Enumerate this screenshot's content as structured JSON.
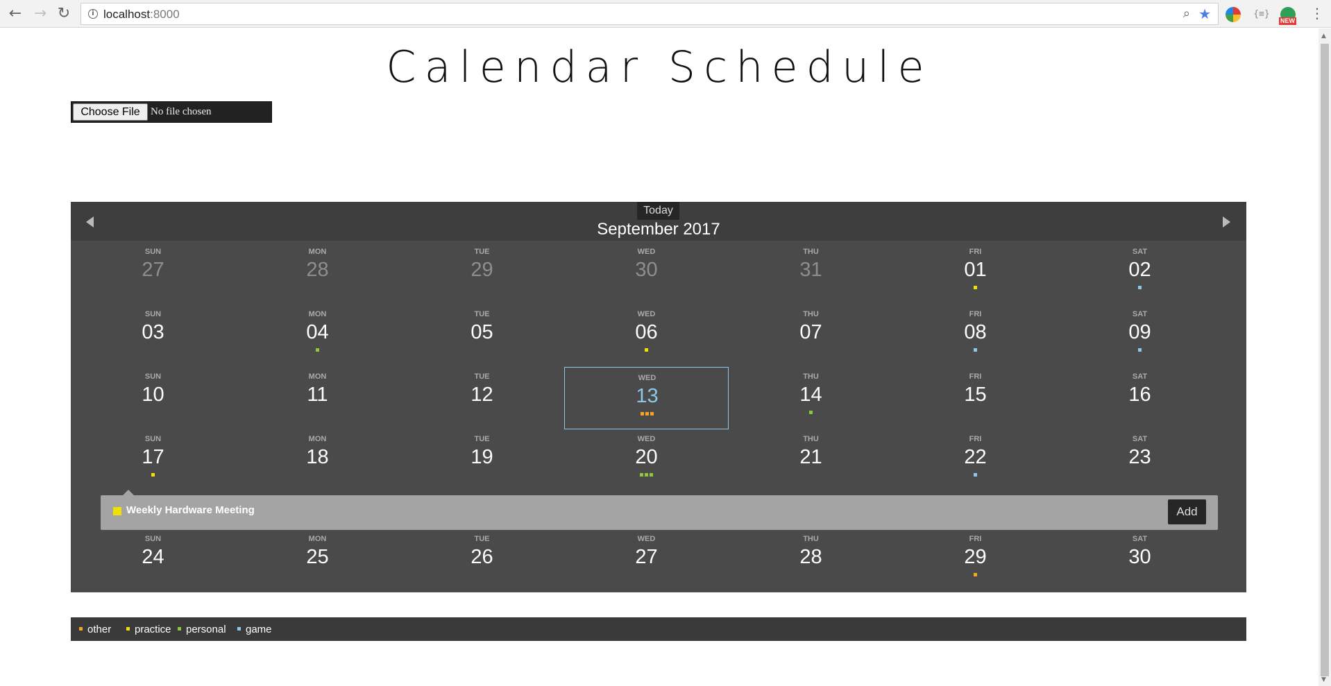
{
  "browser": {
    "url_host": "localhost",
    "url_port": ":8000",
    "ext_new_badge": "NEW",
    "ext_braces": "{≡}"
  },
  "page": {
    "title": "Calendar Schedule",
    "file_input": {
      "button_label": "Choose File",
      "status": "No file chosen"
    }
  },
  "calendar": {
    "today_label": "Today",
    "month_title": "September 2017",
    "weeks": [
      [
        {
          "name": "SUN",
          "num": "27",
          "other": true,
          "dots": []
        },
        {
          "name": "MON",
          "num": "28",
          "other": true,
          "dots": []
        },
        {
          "name": "TUE",
          "num": "29",
          "other": true,
          "dots": []
        },
        {
          "name": "WED",
          "num": "30",
          "other": true,
          "dots": []
        },
        {
          "name": "THU",
          "num": "31",
          "other": true,
          "dots": []
        },
        {
          "name": "FRI",
          "num": "01",
          "dots": [
            "practice"
          ]
        },
        {
          "name": "SAT",
          "num": "02",
          "dots": [
            "game"
          ]
        }
      ],
      [
        {
          "name": "SUN",
          "num": "03",
          "dots": []
        },
        {
          "name": "MON",
          "num": "04",
          "dots": [
            "personal"
          ]
        },
        {
          "name": "TUE",
          "num": "05",
          "dots": []
        },
        {
          "name": "WED",
          "num": "06",
          "dots": [
            "practice"
          ]
        },
        {
          "name": "THU",
          "num": "07",
          "dots": []
        },
        {
          "name": "FRI",
          "num": "08",
          "dots": [
            "game"
          ]
        },
        {
          "name": "SAT",
          "num": "09",
          "dots": [
            "game"
          ]
        }
      ],
      [
        {
          "name": "SUN",
          "num": "10",
          "dots": []
        },
        {
          "name": "MON",
          "num": "11",
          "dots": []
        },
        {
          "name": "TUE",
          "num": "12",
          "dots": []
        },
        {
          "name": "WED",
          "num": "13",
          "selected": true,
          "dots": [
            "other",
            "other",
            "other"
          ]
        },
        {
          "name": "THU",
          "num": "14",
          "dots": [
            "personal"
          ]
        },
        {
          "name": "FRI",
          "num": "15",
          "dots": []
        },
        {
          "name": "SAT",
          "num": "16",
          "dots": []
        }
      ],
      [
        {
          "name": "SUN",
          "num": "17",
          "dots": [
            "practice"
          ]
        },
        {
          "name": "MON",
          "num": "18",
          "dots": []
        },
        {
          "name": "TUE",
          "num": "19",
          "dots": []
        },
        {
          "name": "WED",
          "num": "20",
          "dots": [
            "personal",
            "personal",
            "personal"
          ]
        },
        {
          "name": "THU",
          "num": "21",
          "dots": []
        },
        {
          "name": "FRI",
          "num": "22",
          "dots": [
            "game"
          ]
        },
        {
          "name": "SAT",
          "num": "23",
          "dots": []
        }
      ],
      [
        {
          "name": "SUN",
          "num": "24",
          "dots": []
        },
        {
          "name": "MON",
          "num": "25",
          "dots": []
        },
        {
          "name": "TUE",
          "num": "26",
          "dots": []
        },
        {
          "name": "WED",
          "num": "27",
          "dots": []
        },
        {
          "name": "THU",
          "num": "28",
          "dots": []
        },
        {
          "name": "FRI",
          "num": "29",
          "dots": [
            "other"
          ]
        },
        {
          "name": "SAT",
          "num": "30",
          "dots": []
        }
      ]
    ],
    "event_panel": {
      "title": "Weekly Hardware Meeting",
      "category": "practice",
      "add_label": "Add"
    }
  },
  "categories": {
    "other": "#f5a623",
    "practice": "#f0e100",
    "personal": "#8dc63f",
    "game": "#8ec7e8"
  },
  "legend": [
    {
      "key": "other",
      "label": "other"
    },
    {
      "key": "practice",
      "label": "practice"
    },
    {
      "key": "personal",
      "label": "personal"
    },
    {
      "key": "game",
      "label": "game"
    }
  ]
}
